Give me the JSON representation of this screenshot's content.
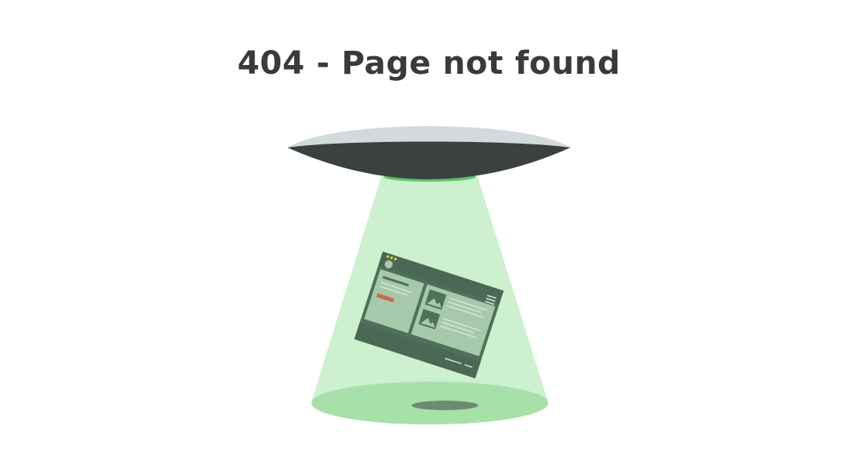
{
  "page": {
    "title": "404 - Page not found"
  },
  "illustration": {
    "name": "ufo-abducting-webpage",
    "colors": {
      "ufo_dome": "#d3dadb",
      "ufo_body": "#3b4040",
      "beam": "#cdf0cf",
      "beam_base": "#a8e0aa",
      "beam_top": "#5cc468",
      "shadow": "#6e8a70",
      "page_frame": "#4f7059",
      "page_panel": "#a7c9ab",
      "page_highlight": "#c66a4a"
    }
  }
}
